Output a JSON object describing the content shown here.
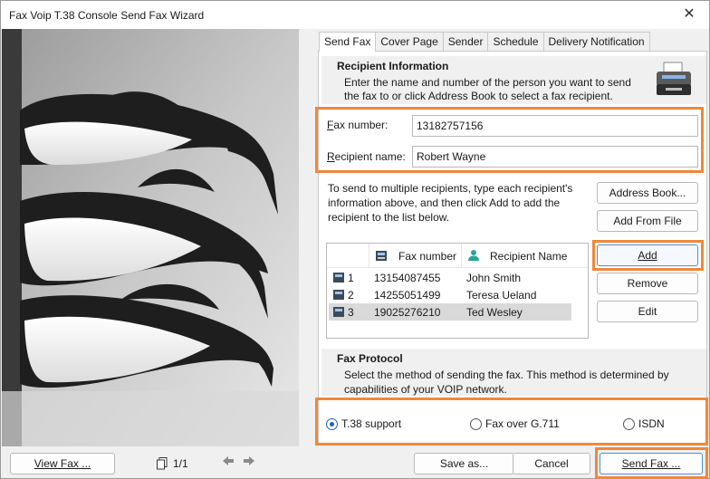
{
  "window": {
    "title": "Fax Voip T.38 Console Send Fax Wizard",
    "close_glyph": "✕"
  },
  "tabs": [
    {
      "label": "Send Fax",
      "active": true
    },
    {
      "label": "Cover Page",
      "active": false
    },
    {
      "label": "Sender",
      "active": false
    },
    {
      "label": "Schedule",
      "active": false
    },
    {
      "label": "Delivery Notification",
      "active": false
    }
  ],
  "recipient_info": {
    "heading": "Recipient Information",
    "description_line1": "Enter the name and number of the person you want to send",
    "description_line2": "the fax to or click Address Book to select a fax recipient.",
    "icon": "fax-machine-icon"
  },
  "fields": {
    "fax_number_label_key": "F",
    "fax_number_label_rest": "ax number:",
    "fax_number_value": "13182757156",
    "recipient_name_label_key": "R",
    "recipient_name_label_rest": "ecipient name:",
    "recipient_name_value": "Robert Wayne"
  },
  "multi": {
    "line1": "To send to multiple recipients, type each recipient's",
    "line2": "information above, and then click Add to add the",
    "line3": "recipient to the list below."
  },
  "buttons": {
    "address_book": "Address Book...",
    "add_from_file": "Add From File",
    "add": "Add",
    "remove": "Remove",
    "edit": "Edit",
    "view_fax": "View Fax ...",
    "save_as": "Save as...",
    "cancel": "Cancel",
    "send_fax": "Send Fax ..."
  },
  "recipients_table": {
    "headers": {
      "fax_number": "Fax number",
      "recipient_name": "Recipient Name"
    },
    "rows": [
      {
        "index": "1",
        "fax": "13154087455",
        "name": "John Smith",
        "selected": false
      },
      {
        "index": "2",
        "fax": "14255051499",
        "name": "Teresa Ueland",
        "selected": false
      },
      {
        "index": "3",
        "fax": "19025276210",
        "name": "Ted Wesley",
        "selected": true
      }
    ]
  },
  "protocol": {
    "heading": "Fax Protocol",
    "description_line1": "Select the method of sending the fax. This method is determined by",
    "description_line2": "capabilities of your VOIP network.",
    "options": [
      {
        "label": "T.38 support",
        "checked": true
      },
      {
        "label": "Fax over G.711",
        "checked": false
      },
      {
        "label": "ISDN",
        "checked": false
      }
    ]
  },
  "pagination": {
    "text": "1/1"
  },
  "colors": {
    "highlight": "#f0873a",
    "primary_border": "#4a8fd8"
  }
}
